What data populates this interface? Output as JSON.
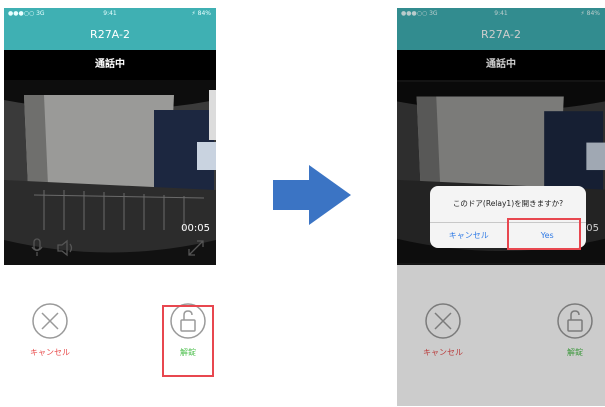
{
  "left_screen": {
    "status": {
      "carrier": "●●●○○ 3G",
      "time": "9:41",
      "battery": "⚡ 84%"
    },
    "title": "R27A-2",
    "call_status": "通話中",
    "timer": "00:05",
    "cancel_label": "キャンセル",
    "unlock_label": "解錠"
  },
  "right_screen": {
    "status": {
      "carrier": "●●●○○ 3G",
      "time": "9:41",
      "battery": "⚡ 84%"
    },
    "title": "R27A-2",
    "call_status": "通話中",
    "timer": "00:05",
    "dialog": {
      "message": "このドア(Relay1)を開きますか?",
      "cancel": "キャンセル",
      "yes": "Yes"
    },
    "cancel_label": "キャンセル",
    "unlock_label": "解錠"
  },
  "colors": {
    "header": "#3fb0b3",
    "cancel": "#e84a4a",
    "unlock": "#4bbf4b",
    "highlight": "#e8474f",
    "arrow": "#3b74c4",
    "dialog_button": "#2f7ae5"
  },
  "icons": [
    "microphone-icon",
    "speaker-icon",
    "expand-icon",
    "cancel-x-icon",
    "padlock-icon",
    "arrow-right-icon"
  ]
}
